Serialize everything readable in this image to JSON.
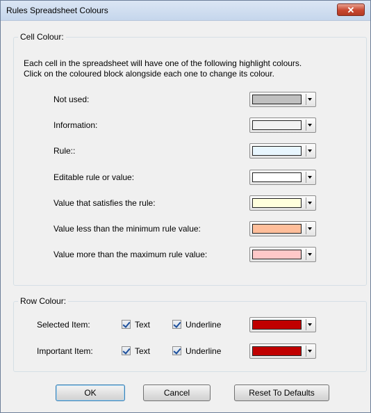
{
  "window": {
    "title": "Rules Spreadsheet Colours",
    "close_label": "✕"
  },
  "cell_colour": {
    "legend": "Cell Colour:",
    "description_line1": "Each cell in the spreadsheet will have one of the following  highlight colours.",
    "description_line2": "Click on the coloured block alongside each one to change its colour.",
    "rows": [
      {
        "label": "Not used:",
        "color": "#c0c0c0"
      },
      {
        "label": "Information:",
        "color": "#f2f2f2"
      },
      {
        "label": "Rule::",
        "color": "#e8f6fe"
      },
      {
        "label": "Editable rule or value:",
        "color": "#ffffff"
      },
      {
        "label": "Value that satisfies the rule:",
        "color": "#ffffdd"
      },
      {
        "label": "Value less than the minimum rule value:",
        "color": "#ffbe9a"
      },
      {
        "label": "Value more than the maximum rule value:",
        "color": "#ffc8c8"
      }
    ]
  },
  "row_colour": {
    "legend": "Row Colour:",
    "rows": [
      {
        "label": "Selected Item:",
        "text_label": "Text",
        "text_checked": true,
        "underline_label": "Underline",
        "underline_checked": true,
        "color": "#c00000"
      },
      {
        "label": "Important Item:",
        "text_label": "Text",
        "text_checked": true,
        "underline_label": "Underline",
        "underline_checked": true,
        "color": "#c00000"
      }
    ]
  },
  "buttons": {
    "ok": "OK",
    "cancel": "Cancel",
    "reset": "Reset To Defaults"
  }
}
